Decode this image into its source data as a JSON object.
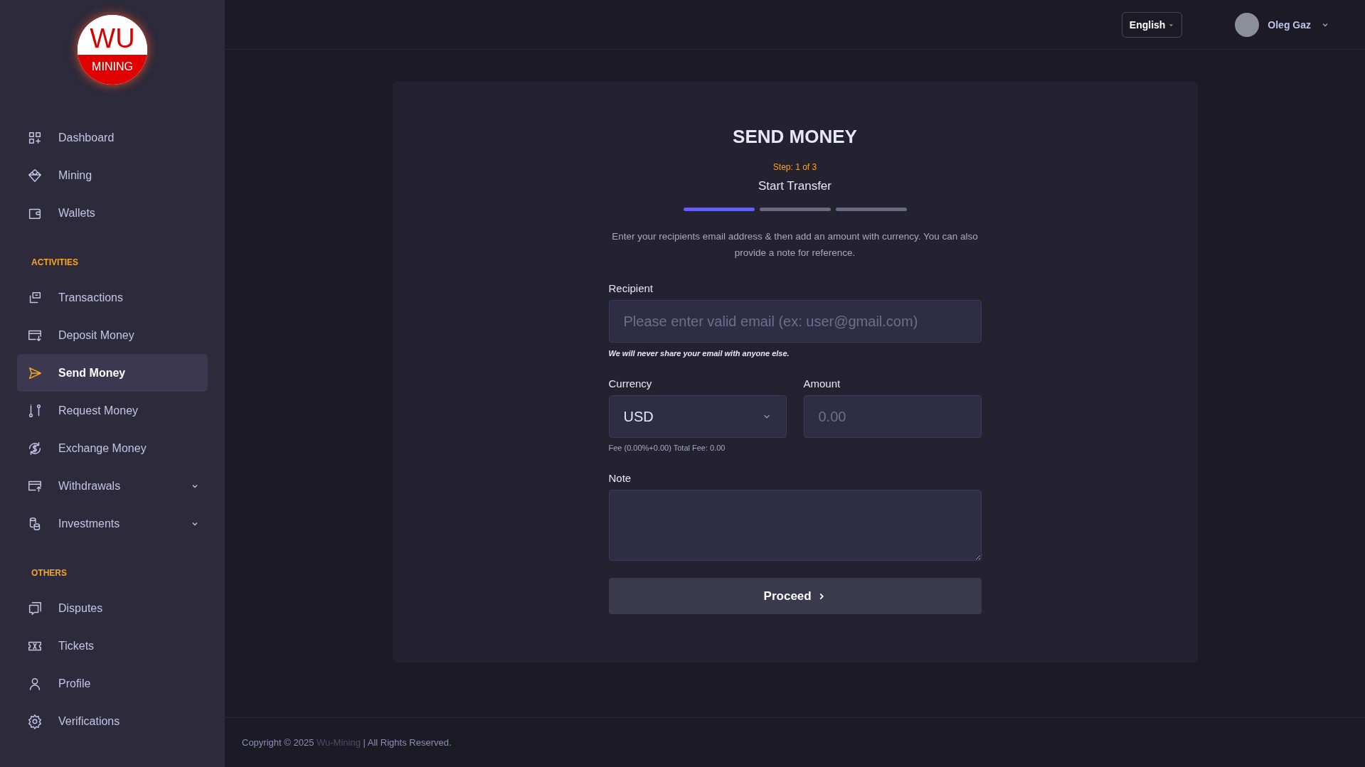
{
  "sidebar": {
    "logo": {
      "top": "WU",
      "bottom": "MINING"
    },
    "sections": [
      {
        "items": [
          {
            "label": "Dashboard",
            "selected": false,
            "expandable": false
          },
          {
            "label": "Mining",
            "selected": false,
            "expandable": false
          },
          {
            "label": "Wallets",
            "selected": false,
            "expandable": false
          }
        ]
      },
      {
        "heading": "ACTIVITIES",
        "items": [
          {
            "label": "Transactions",
            "selected": false,
            "expandable": false
          },
          {
            "label": "Deposit Money",
            "selected": false,
            "expandable": false
          },
          {
            "label": "Send Money",
            "selected": true,
            "expandable": false
          },
          {
            "label": "Request Money",
            "selected": false,
            "expandable": false
          },
          {
            "label": "Exchange Money",
            "selected": false,
            "expandable": false
          },
          {
            "label": "Withdrawals",
            "selected": false,
            "expandable": true
          },
          {
            "label": "Investments",
            "selected": false,
            "expandable": true
          }
        ]
      },
      {
        "heading": "OTHERS",
        "items": [
          {
            "label": "Disputes",
            "selected": false,
            "expandable": false
          },
          {
            "label": "Tickets",
            "selected": false,
            "expandable": false
          },
          {
            "label": "Profile",
            "selected": false,
            "expandable": false
          },
          {
            "label": "Verifications",
            "selected": false,
            "expandable": false
          }
        ]
      }
    ]
  },
  "header": {
    "language": "English",
    "user": {
      "name": "Oleg Gaz"
    }
  },
  "form": {
    "title": "SEND MONEY",
    "step": "Step: 1 of 3",
    "step_title": "Start Transfer",
    "steps": [
      {
        "active": true
      },
      {
        "active": false
      },
      {
        "active": false
      }
    ],
    "description": "Enter your recipients email address & then add an amount with currency. You can also provide a note for reference.",
    "recipient": {
      "label": "Recipient",
      "placeholder": "Please enter valid email (ex: user@gmail.com)",
      "hint": "We will never share your email with anyone else."
    },
    "currency": {
      "label": "Currency",
      "value": "USD"
    },
    "amount": {
      "label": "Amount",
      "placeholder": "0.00"
    },
    "fee": "Fee (0.00%+0.00) Total Fee: 0.00",
    "note": {
      "label": "Note"
    },
    "button": "Proceed"
  },
  "footer": {
    "before": "Copyright © 2025",
    "link": "Wu-Mining",
    "after": "| All Rights Reserved."
  }
}
